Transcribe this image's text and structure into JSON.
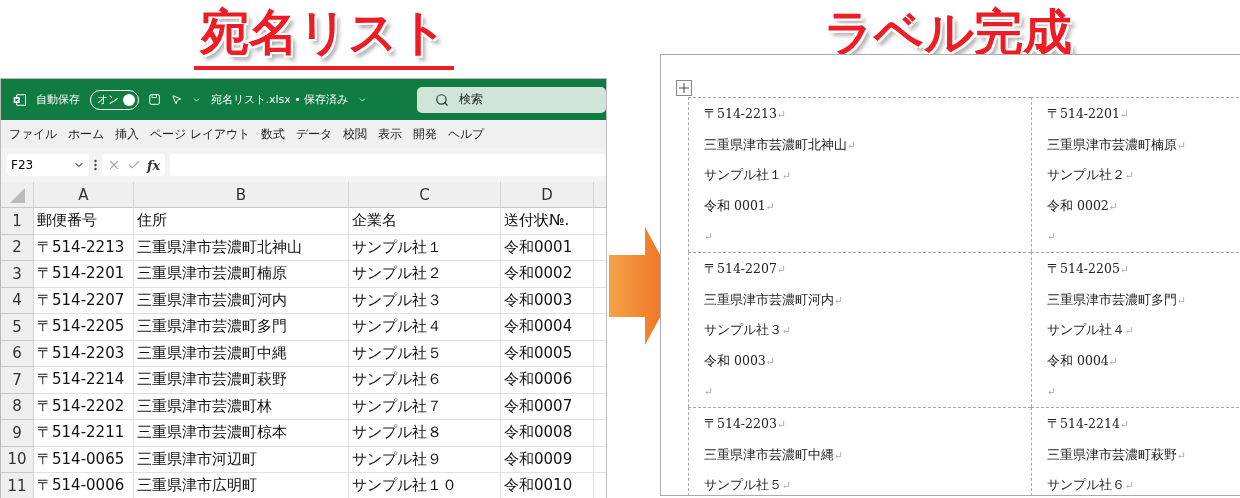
{
  "titles": {
    "left": "宛名リスト",
    "right": "ラベル完成"
  },
  "excel": {
    "autosave_label": "自動保存",
    "autosave": {
      "label": "オン",
      "on": true
    },
    "file_title": "宛名リスト.xlsx • 保存済み",
    "search": {
      "placeholder": "検索"
    },
    "menu": [
      "ファイル",
      "ホーム",
      "挿入",
      "ページ レイアウト",
      "数式",
      "データ",
      "校閲",
      "表示",
      "開発",
      "ヘルプ"
    ],
    "name_box": "F23",
    "formula_label": "fx",
    "columns": [
      "A",
      "B",
      "C",
      "D"
    ],
    "rows": [
      {
        "number": "1",
        "cells": [
          "郵便番号",
          "住所",
          "企業名",
          "送付状№."
        ]
      },
      {
        "number": "2",
        "cells": [
          "〒514-2213",
          "三重県津市芸濃町北神山",
          "サンプル社１",
          "令和0001"
        ]
      },
      {
        "number": "3",
        "cells": [
          "〒514-2201",
          "三重県津市芸濃町楠原",
          "サンプル社２",
          "令和0002"
        ]
      },
      {
        "number": "4",
        "cells": [
          "〒514-2207",
          "三重県津市芸濃町河内",
          "サンプル社３",
          "令和0003"
        ]
      },
      {
        "number": "5",
        "cells": [
          "〒514-2205",
          "三重県津市芸濃町多門",
          "サンプル社４",
          "令和0004"
        ]
      },
      {
        "number": "6",
        "cells": [
          "〒514-2203",
          "三重県津市芸濃町中縄",
          "サンプル社５",
          "令和0005"
        ]
      },
      {
        "number": "7",
        "cells": [
          "〒514-2214",
          "三重県津市芸濃町萩野",
          "サンプル社６",
          "令和0006"
        ]
      },
      {
        "number": "8",
        "cells": [
          "〒514-2202",
          "三重県津市芸濃町林",
          "サンプル社７",
          "令和0007"
        ]
      },
      {
        "number": "9",
        "cells": [
          "〒514-2211",
          "三重県津市芸濃町椋本",
          "サンプル社８",
          "令和0008"
        ]
      },
      {
        "number": "10",
        "cells": [
          "〒514-0065",
          "三重県津市河辺町",
          "サンプル社９",
          "令和0009"
        ]
      },
      {
        "number": "11",
        "cells": [
          "〒514-0006",
          "三重県津市広明町",
          "サンプル社１０",
          "令和0010"
        ]
      }
    ]
  },
  "labels": [
    {
      "lines": [
        {
          "text": "〒514-2213",
          "mark": "↵"
        },
        {
          "text": "三重県津市芸濃町北神山",
          "mark": "↵"
        },
        {
          "text": "サンプル社１",
          "mark": "↵"
        },
        {
          "text": "令和 0001",
          "mark": "↵"
        },
        {
          "mark": "↵"
        }
      ]
    },
    {
      "lines": [
        {
          "text": "〒514-2201",
          "mark": "↵"
        },
        {
          "text": "三重県津市芸濃町楠原",
          "mark": "↵"
        },
        {
          "text": "サンプル社２",
          "mark": "↵"
        },
        {
          "text": "令和 0002",
          "mark": "↵"
        },
        {
          "mark": "↵"
        }
      ]
    },
    {
      "lines": [
        {
          "text": "〒514-2207",
          "mark": "↵"
        },
        {
          "text": "三重県津市芸濃町河内",
          "mark": "↵"
        },
        {
          "text": "サンプル社３",
          "mark": "↵"
        },
        {
          "text": "令和 0003",
          "mark": "↵"
        },
        {
          "mark": "↵"
        }
      ]
    },
    {
      "lines": [
        {
          "text": "〒514-2205",
          "mark": "↵"
        },
        {
          "text": "三重県津市芸濃町多門",
          "mark": "↵"
        },
        {
          "text": "サンプル社４",
          "mark": "↵"
        },
        {
          "text": "令和 0004",
          "mark": "↵"
        },
        {
          "mark": "↵"
        }
      ]
    },
    {
      "lines": [
        {
          "text": "〒514-2203",
          "mark": "↵"
        },
        {
          "text": "三重県津市芸濃町中縄",
          "mark": "↵"
        },
        {
          "text": "サンプル社５",
          "mark": "↵"
        }
      ]
    },
    {
      "lines": [
        {
          "text": "〒514-2214",
          "mark": "↵"
        },
        {
          "text": "三重県津市芸濃町萩野",
          "mark": "↵"
        },
        {
          "text": "サンプル社６",
          "mark": "↵"
        }
      ]
    }
  ]
}
